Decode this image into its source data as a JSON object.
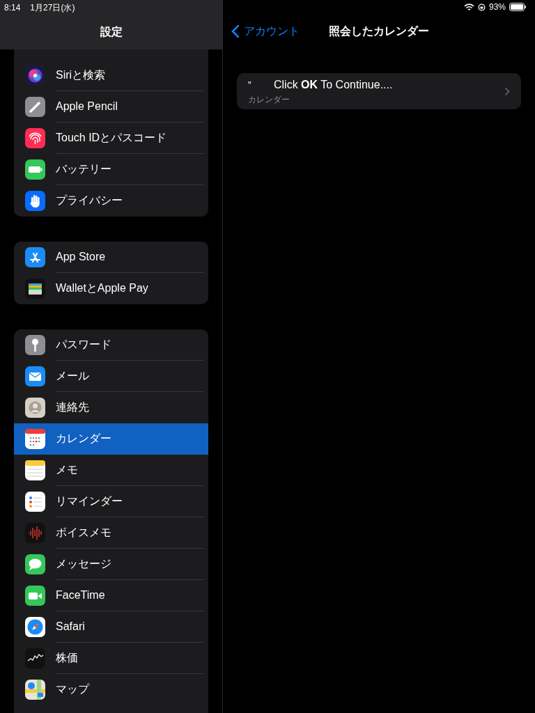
{
  "status_bar": {
    "time": "8:14",
    "date": "1月27日(水)",
    "battery": "93%"
  },
  "sidebar": {
    "title": "設定",
    "groups": [
      {
        "items": [
          {
            "label": "Siriと検索",
            "selected": false
          },
          {
            "label": "Apple Pencil",
            "selected": false
          },
          {
            "label": "Touch IDとパスコード",
            "selected": false
          },
          {
            "label": "バッテリー",
            "selected": false
          },
          {
            "label": "プライバシー",
            "selected": false
          }
        ]
      },
      {
        "items": [
          {
            "label": "App Store",
            "selected": false
          },
          {
            "label": "WalletとApple Pay",
            "selected": false
          }
        ]
      },
      {
        "items": [
          {
            "label": "パスワード",
            "selected": false
          },
          {
            "label": "メール",
            "selected": false
          },
          {
            "label": "連絡先",
            "selected": false
          },
          {
            "label": "カレンダー",
            "selected": true
          },
          {
            "label": "メモ",
            "selected": false
          },
          {
            "label": "リマインダー",
            "selected": false
          },
          {
            "label": "ボイスメモ",
            "selected": false
          },
          {
            "label": "メッセージ",
            "selected": false
          },
          {
            "label": "FaceTime",
            "selected": false
          },
          {
            "label": "Safari",
            "selected": false
          },
          {
            "label": "株価",
            "selected": false
          },
          {
            "label": "マップ",
            "selected": false
          }
        ]
      }
    ]
  },
  "detail": {
    "back": "アカウント",
    "title": "照会したカレンダー",
    "rows": [
      {
        "mark": "”",
        "title": "Click **OK** To Continue....",
        "subtitle": "カレンダー"
      }
    ]
  }
}
